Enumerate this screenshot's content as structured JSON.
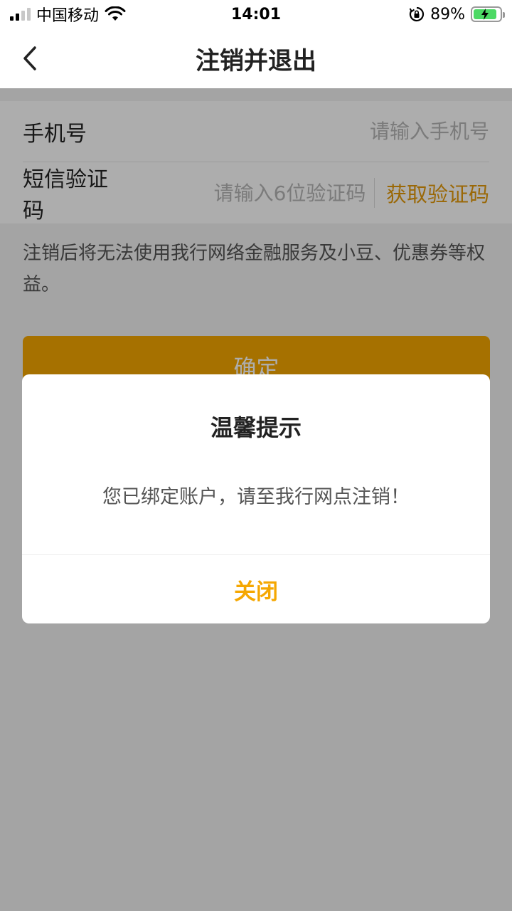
{
  "status_bar": {
    "carrier": "中国移动",
    "time": "14:01",
    "battery_percent": "89%",
    "battery_level": 0.89,
    "signal_bars_active": 2,
    "signal_bars_total": 4,
    "icons": [
      "signal-icon",
      "wifi-icon",
      "rotation-lock-icon",
      "battery-charging-icon"
    ]
  },
  "nav": {
    "title": "注销并退出",
    "back_icon": "chevron-left-icon"
  },
  "form": {
    "phone_label": "手机号",
    "phone_placeholder": "请输入手机号",
    "phone_value": "",
    "sms_label": "短信验证码",
    "sms_placeholder": "请输入6位验证码",
    "sms_value": "",
    "get_code_label": "获取验证码"
  },
  "notice": "注销后将无法使用我行网络金融服务及小豆、优惠券等权益。",
  "confirm_label": "确定",
  "dialog": {
    "title": "温馨提示",
    "message": "您已绑定账户，请至我行网点注销！",
    "close_label": "关闭"
  },
  "colors": {
    "accent": "#f5a701",
    "link": "#e39a0b",
    "overlay": "rgba(0,0,0,0.32)"
  }
}
